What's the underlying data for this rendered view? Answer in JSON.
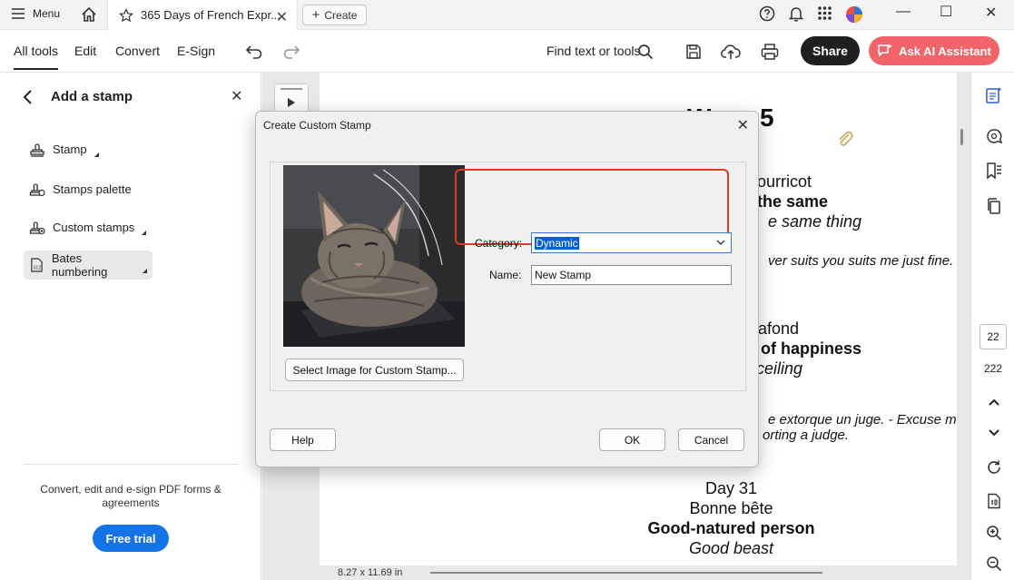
{
  "titlebar": {
    "menu_label": "Menu",
    "tab_title": "365 Days of French Expr...",
    "create_label": "Create"
  },
  "toolbar": {
    "tabs": [
      "All tools",
      "Edit",
      "Convert",
      "E-Sign"
    ],
    "find_label": "Find text or tools",
    "share_label": "Share",
    "ai_label": "Ask AI Assistant"
  },
  "left_panel": {
    "title": "Add a stamp",
    "items": [
      "Stamp",
      "Stamps palette",
      "Custom stamps",
      "Bates numbering"
    ],
    "promo_text": "Convert, edit and e-sign PDF forms & agreements",
    "trial_label": "Free trial"
  },
  "document": {
    "heading_partial": "W",
    "heading_suffix": "5",
    "lines": [
      "ourricot",
      "the same",
      "e same thing",
      "ver suits you suits me just fine.",
      "afond",
      "s of happiness",
      "ceiling",
      "e extorque un juge. - Excuse me",
      "orting a judge.",
      "Day 31",
      "Bonne bête",
      "Good-natured person",
      "Good beast"
    ],
    "page_size": "8.27 x 11.69 in"
  },
  "right_rail": {
    "current_page": "22",
    "total_pages": "222"
  },
  "dialog": {
    "title": "Create Custom Stamp",
    "select_image_label": "Select Image for Custom Stamp...",
    "category_label": "Category:",
    "category_value": "Dynamic",
    "name_label": "Name:",
    "name_value": "New Stamp",
    "help_label": "Help",
    "ok_label": "OK",
    "cancel_label": "Cancel"
  },
  "colors": {
    "accent_blue": "#1473e6",
    "share_bg": "#1f1f1f",
    "ai_bg": "#f0646a",
    "highlight": "#dc3b26",
    "selection": "#0a5fd0"
  }
}
